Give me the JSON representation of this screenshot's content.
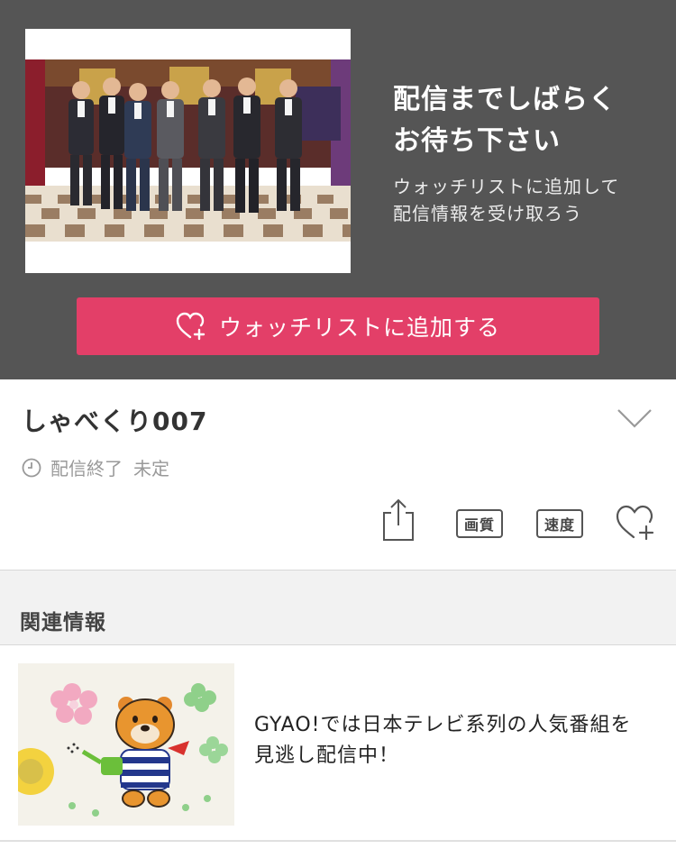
{
  "promo": {
    "title": "配信までしばらく\nお待ち下さい",
    "subtitle": "ウォッチリストに追加して\n配信情報を受け取ろう",
    "watch_button_label": "ウォッチリストに追加する"
  },
  "program": {
    "title": "しゃべくり007",
    "status_label": "配信終了",
    "status_value": "未定"
  },
  "actions": {
    "quality_label": "画質",
    "speed_label": "速度"
  },
  "related": {
    "heading": "関連情報",
    "items": [
      {
        "text": "GYAO!では日本テレビ系列の人気番組を見逃し配信中！"
      }
    ]
  },
  "colors": {
    "promo_bg": "#555555",
    "accent": "#e33f68",
    "section_bg": "#f2f2f2"
  },
  "icons": [
    "heart-plus-icon",
    "chevron-down-icon",
    "clock-icon",
    "share-icon",
    "heart-plus-icon"
  ]
}
